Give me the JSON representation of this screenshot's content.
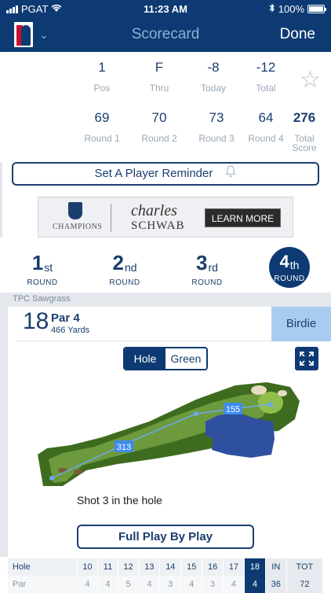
{
  "status_bar": {
    "carrier": "PGAT",
    "time": "11:23 AM",
    "battery": "100%"
  },
  "nav": {
    "title": "Scorecard",
    "done_label": "Done",
    "logo": "pga-tour-logo"
  },
  "summary": {
    "pos": {
      "value": "1",
      "label": "Pos"
    },
    "thru": {
      "value": "F",
      "label": "Thru"
    },
    "today": {
      "value": "-8",
      "label": "Today"
    },
    "total": {
      "value": "-12",
      "label": "Total"
    }
  },
  "rounds_scores": [
    {
      "value": "69",
      "label": "Round 1"
    },
    {
      "value": "70",
      "label": "Round 2"
    },
    {
      "value": "73",
      "label": "Round 3"
    },
    {
      "value": "64",
      "label": "Round 4"
    },
    {
      "value": "276",
      "label": "Total Score"
    }
  ],
  "reminder_label": "Set A Player Reminder",
  "ad": {
    "brand_left": "CHAMPIONS",
    "brand_line1": "charles",
    "brand_line2": "SCHWAB",
    "cta": "LEARN MORE"
  },
  "round_tabs": [
    {
      "num": "1",
      "suffix": "st",
      "label": "ROUND"
    },
    {
      "num": "2",
      "suffix": "nd",
      "label": "ROUND"
    },
    {
      "num": "3",
      "suffix": "rd",
      "label": "ROUND"
    },
    {
      "num": "4",
      "suffix": "th",
      "label": "ROUND",
      "active": true
    }
  ],
  "course": "TPC Sawgrass",
  "hole": {
    "number": "18",
    "par": "Par 4",
    "yards": "466 Yards",
    "result": "Birdie"
  },
  "view_toggle": {
    "hole": "Hole",
    "green": "Green",
    "selected": "Hole"
  },
  "shots": {
    "first": "313",
    "second": "155"
  },
  "shot_status": "Shot 3 in the hole",
  "pbp_label": "Full Play By Play",
  "table": {
    "hole_label": "Hole",
    "par_label": "Par",
    "holes": [
      "10",
      "11",
      "12",
      "13",
      "14",
      "15",
      "16",
      "17",
      "18",
      "IN",
      "TOT"
    ],
    "pars": [
      "4",
      "4",
      "5",
      "4",
      "3",
      "4",
      "3",
      "4",
      "4",
      "36",
      "72"
    ]
  },
  "colors": {
    "navy": "#0d3a73",
    "birdie": "#a8ccf0",
    "fairway": "#5b8a32",
    "water": "#2f4fa0"
  }
}
